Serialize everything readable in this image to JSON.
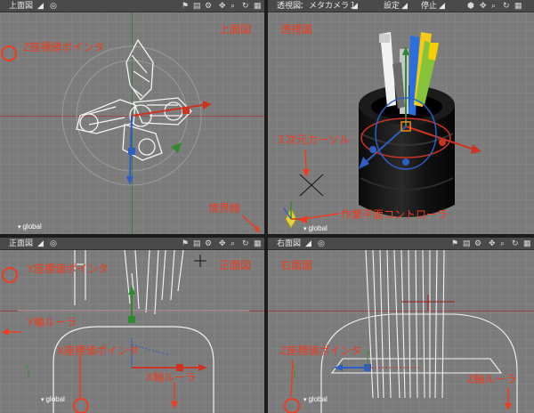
{
  "panes": {
    "top": {
      "title": "上面図",
      "callout": "上面図",
      "global": "global"
    },
    "perspective": {
      "title": "透視図",
      "camera": "メタカメラ１",
      "settings": "設定",
      "stop": "停止",
      "callout": "透視図",
      "global": "global"
    },
    "front": {
      "title": "正面図",
      "callout": "正面図",
      "global": "global"
    },
    "right": {
      "title": "右面図",
      "callout": "右面図",
      "global": "global"
    }
  },
  "annotations": {
    "z_pointer_top": "Z座標値ポインタ",
    "boundary": "境界線",
    "cursor3d": "３次元カーソル",
    "work_plane": "作業平面コントローラ",
    "y_pointer": "Y座標値ポインタ",
    "y_ruler": "Y軸ルーラ",
    "x_pointer": "X座標値ポインタ",
    "x_ruler": "X軸ルーラ",
    "z_pointer_right": "Z座標値ポインタ",
    "z_ruler": "Z軸ルーラ"
  },
  "icons": {
    "toolbar": [
      "wand-icon",
      "align-icon",
      "gear-icon",
      "move-icon",
      "zoom-icon",
      "rotate-icon",
      "maximize-icon"
    ],
    "snapshot": "snapshot-icon"
  },
  "colors": {
    "callout": "#f03c1e",
    "viewport": "#7b7b7b",
    "titlebar": "#4a4a4a"
  }
}
